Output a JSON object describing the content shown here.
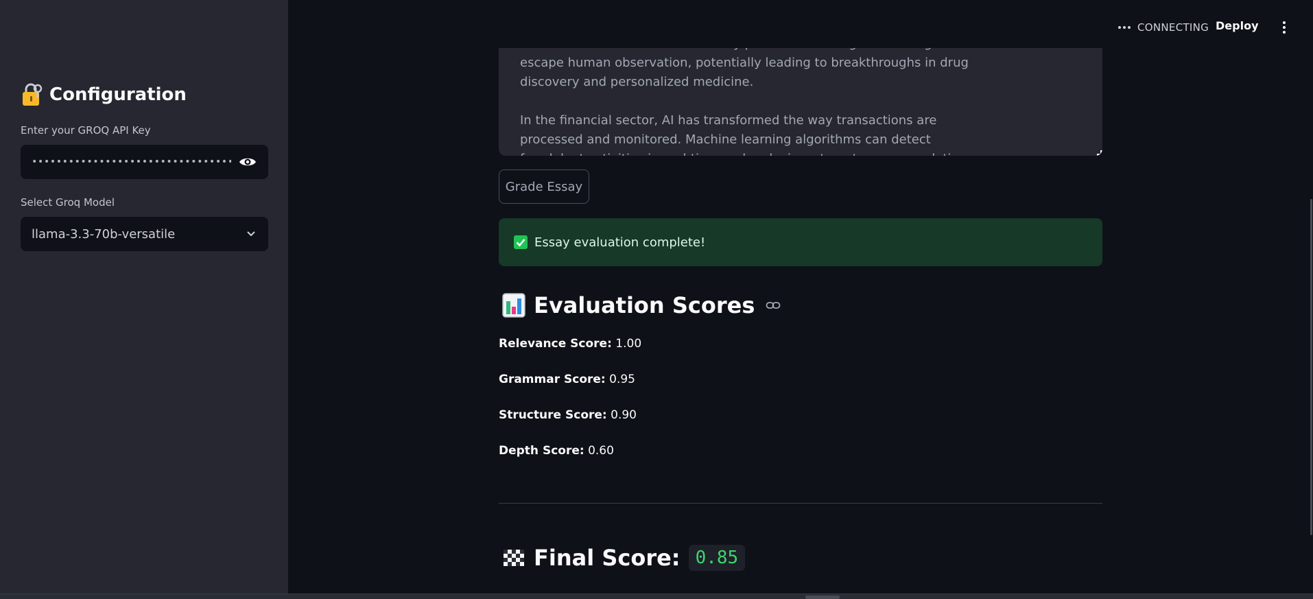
{
  "sidebar": {
    "title": "Configuration",
    "api_key_label": "Enter your GROQ API Key",
    "api_key_value": "••••••••••••••••••••••••••••••••••••••••••••••••",
    "model_label": "Select Groq Model",
    "model_selected": "llama-3.3-70b-versatile"
  },
  "header": {
    "status": "CONNECTING",
    "deploy_label": "Deploy"
  },
  "essay": {
    "paragraphs": [
      "amounts of medical data to identify patterns and insights that might escape human observation, potentially leading to breakthroughs in drug discovery and personalized medicine.",
      "In the financial sector, AI has transformed the way transactions are processed and monitored. Machine learning algorithms can detect fraudulent activities in real-time and make investment recommendations in situations unlike. Risk analyst"
    ]
  },
  "grade_button_label": "Grade Essay",
  "success_message": "Essay evaluation complete!",
  "evaluation": {
    "heading": "Evaluation Scores",
    "scores": [
      {
        "label": "Relevance Score:",
        "value": "1.00"
      },
      {
        "label": "Grammar Score:",
        "value": "0.95"
      },
      {
        "label": "Structure Score:",
        "value": "0.90"
      },
      {
        "label": "Depth Score:",
        "value": "0.60"
      }
    ]
  },
  "final": {
    "label": "Final Score:",
    "value": "0.85"
  },
  "colors": {
    "background": "#0e1117",
    "sidebar": "#262730",
    "success_bg": "#173928",
    "success_check": "#21c354",
    "final_value": "#3dd56d"
  },
  "icons": {
    "title_icon": "lock-key-icon",
    "password_toggle": "eye-icon",
    "select_arrow": "chevron-down-icon",
    "menu": "kebab-menu-icon",
    "success": "check-box-icon",
    "evaluation": "bar-chart-icon",
    "anchor": "link-icon",
    "final": "checkered-flag-icon"
  }
}
